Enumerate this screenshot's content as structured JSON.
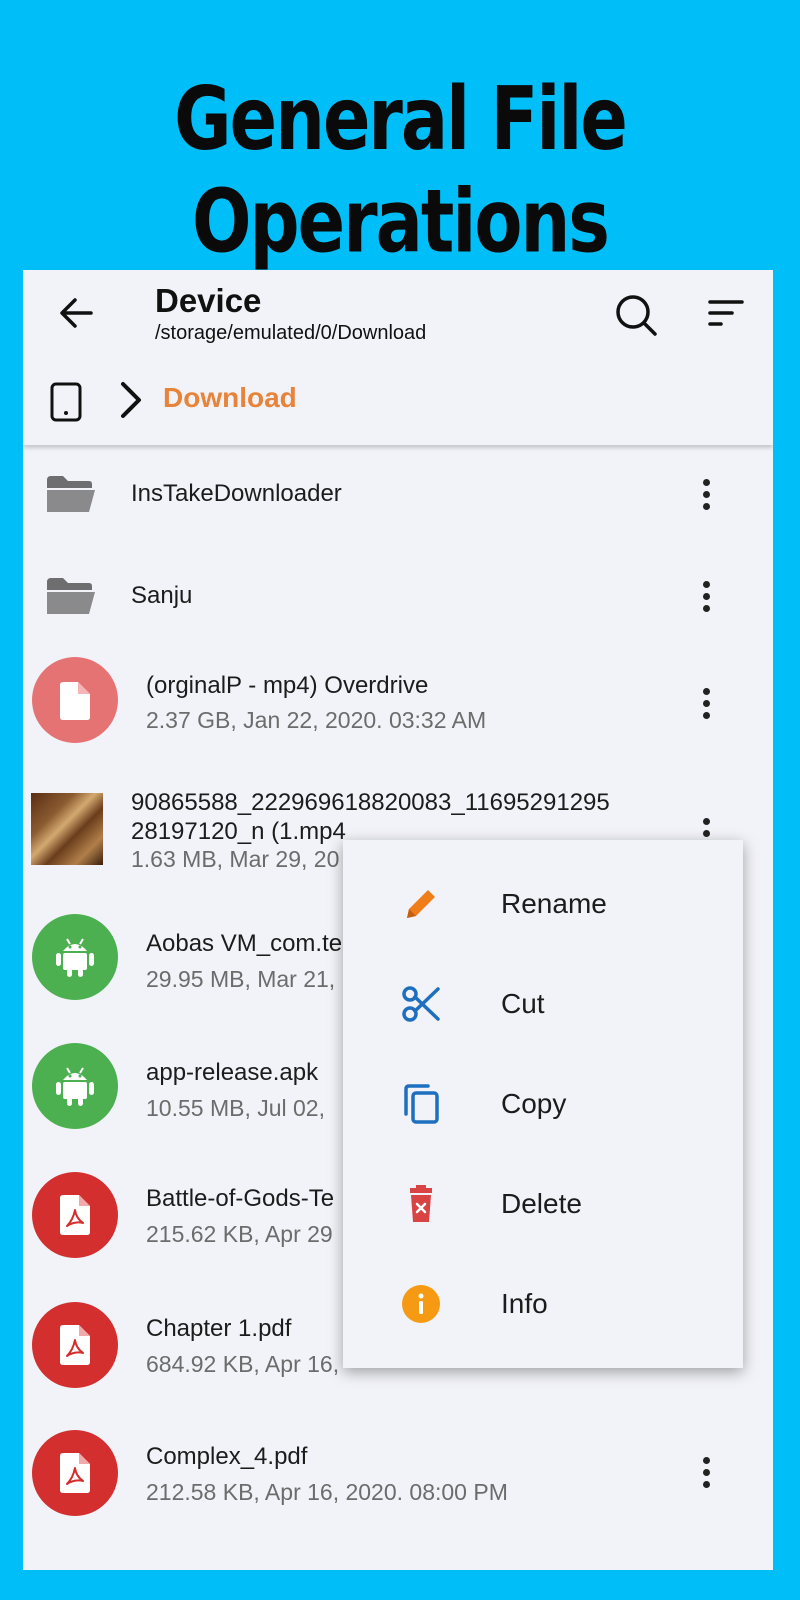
{
  "banner": {
    "title": "General File Operations"
  },
  "appbar": {
    "title": "Device",
    "path": "/storage/emulated/0/Download",
    "breadcrumb": "Download"
  },
  "colors": {
    "background": "#00bff8",
    "accent": "#e8833a",
    "apk": "#4caf50",
    "pdf": "#d32f2f",
    "video": "#e57373"
  },
  "files": [
    {
      "name": "InsTakeDownloader",
      "meta": "",
      "icon": "folder-icon"
    },
    {
      "name": "Sanju",
      "meta": "",
      "icon": "folder-icon"
    },
    {
      "name": "(orginalP - mp4) Overdrive",
      "meta": "2.37 GB, Jan 22, 2020. 03:32 AM",
      "icon": "document-icon"
    },
    {
      "name": "90865588_222969618820083_11695291295",
      "name2": "28197120_n (1.mp4",
      "meta": "1.63 MB, Mar 29, 20",
      "icon": "video-thumbnail"
    },
    {
      "name": "Aobas VM_com.te",
      "meta": "29.95 MB, Mar 21,",
      "icon": "android-icon"
    },
    {
      "name": "app-release.apk",
      "meta": "10.55 MB, Jul 02,",
      "icon": "android-icon"
    },
    {
      "name": "Battle-of-Gods-Te",
      "meta": "215.62 KB, Apr 29",
      "icon": "pdf-icon"
    },
    {
      "name": "Chapter 1.pdf",
      "meta": "684.92 KB, Apr 16,",
      "icon": "pdf-icon"
    },
    {
      "name": "Complex_4.pdf",
      "meta": "212.58 KB, Apr 16, 2020. 08:00 PM",
      "icon": "pdf-icon"
    }
  ],
  "menu": [
    {
      "label": "Rename",
      "icon": "pencil-icon"
    },
    {
      "label": "Cut",
      "icon": "scissors-icon"
    },
    {
      "label": "Copy",
      "icon": "copy-icon"
    },
    {
      "label": "Delete",
      "icon": "trash-icon"
    },
    {
      "label": "Info",
      "icon": "info-icon"
    }
  ]
}
